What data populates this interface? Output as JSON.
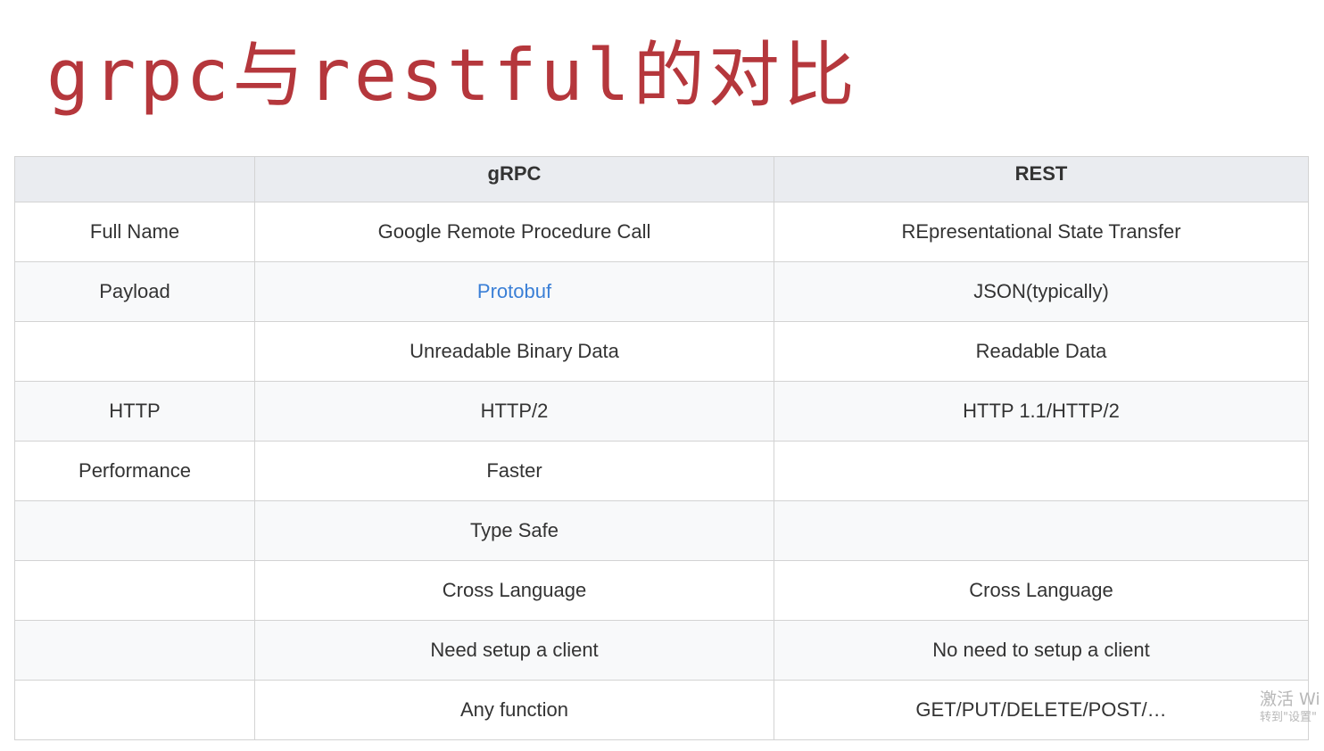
{
  "title": "grpc与restful的对比",
  "table": {
    "headers": [
      "",
      "gRPC",
      "REST"
    ],
    "rows": [
      {
        "label": "Full Name",
        "grpc": "Google Remote Procedure Call",
        "rest": "REpresentational State Transfer"
      },
      {
        "label": "Payload",
        "grpc": "Protobuf",
        "rest": "JSON(typically)"
      },
      {
        "label": "",
        "grpc": "Unreadable Binary Data",
        "rest": "Readable Data"
      },
      {
        "label": "HTTP",
        "grpc": "HTTP/2",
        "rest": "HTTP 1.1/HTTP/2"
      },
      {
        "label": "Performance",
        "grpc": "Faster",
        "rest": ""
      },
      {
        "label": "",
        "grpc": "Type Safe",
        "rest": ""
      },
      {
        "label": "",
        "grpc": "Cross Language",
        "rest": "Cross Language"
      },
      {
        "label": "",
        "grpc": "Need setup a client",
        "rest": "No need to setup a client"
      },
      {
        "label": "",
        "grpc": "Any function",
        "rest": "GET/PUT/DELETE/POST/…"
      }
    ]
  },
  "watermark": {
    "line1": "激活 Wi",
    "line2": "转到\"设置\""
  },
  "colors": {
    "title": "#b5373c",
    "header_bg": "#eaecf0",
    "link": "#3a7fd6"
  }
}
